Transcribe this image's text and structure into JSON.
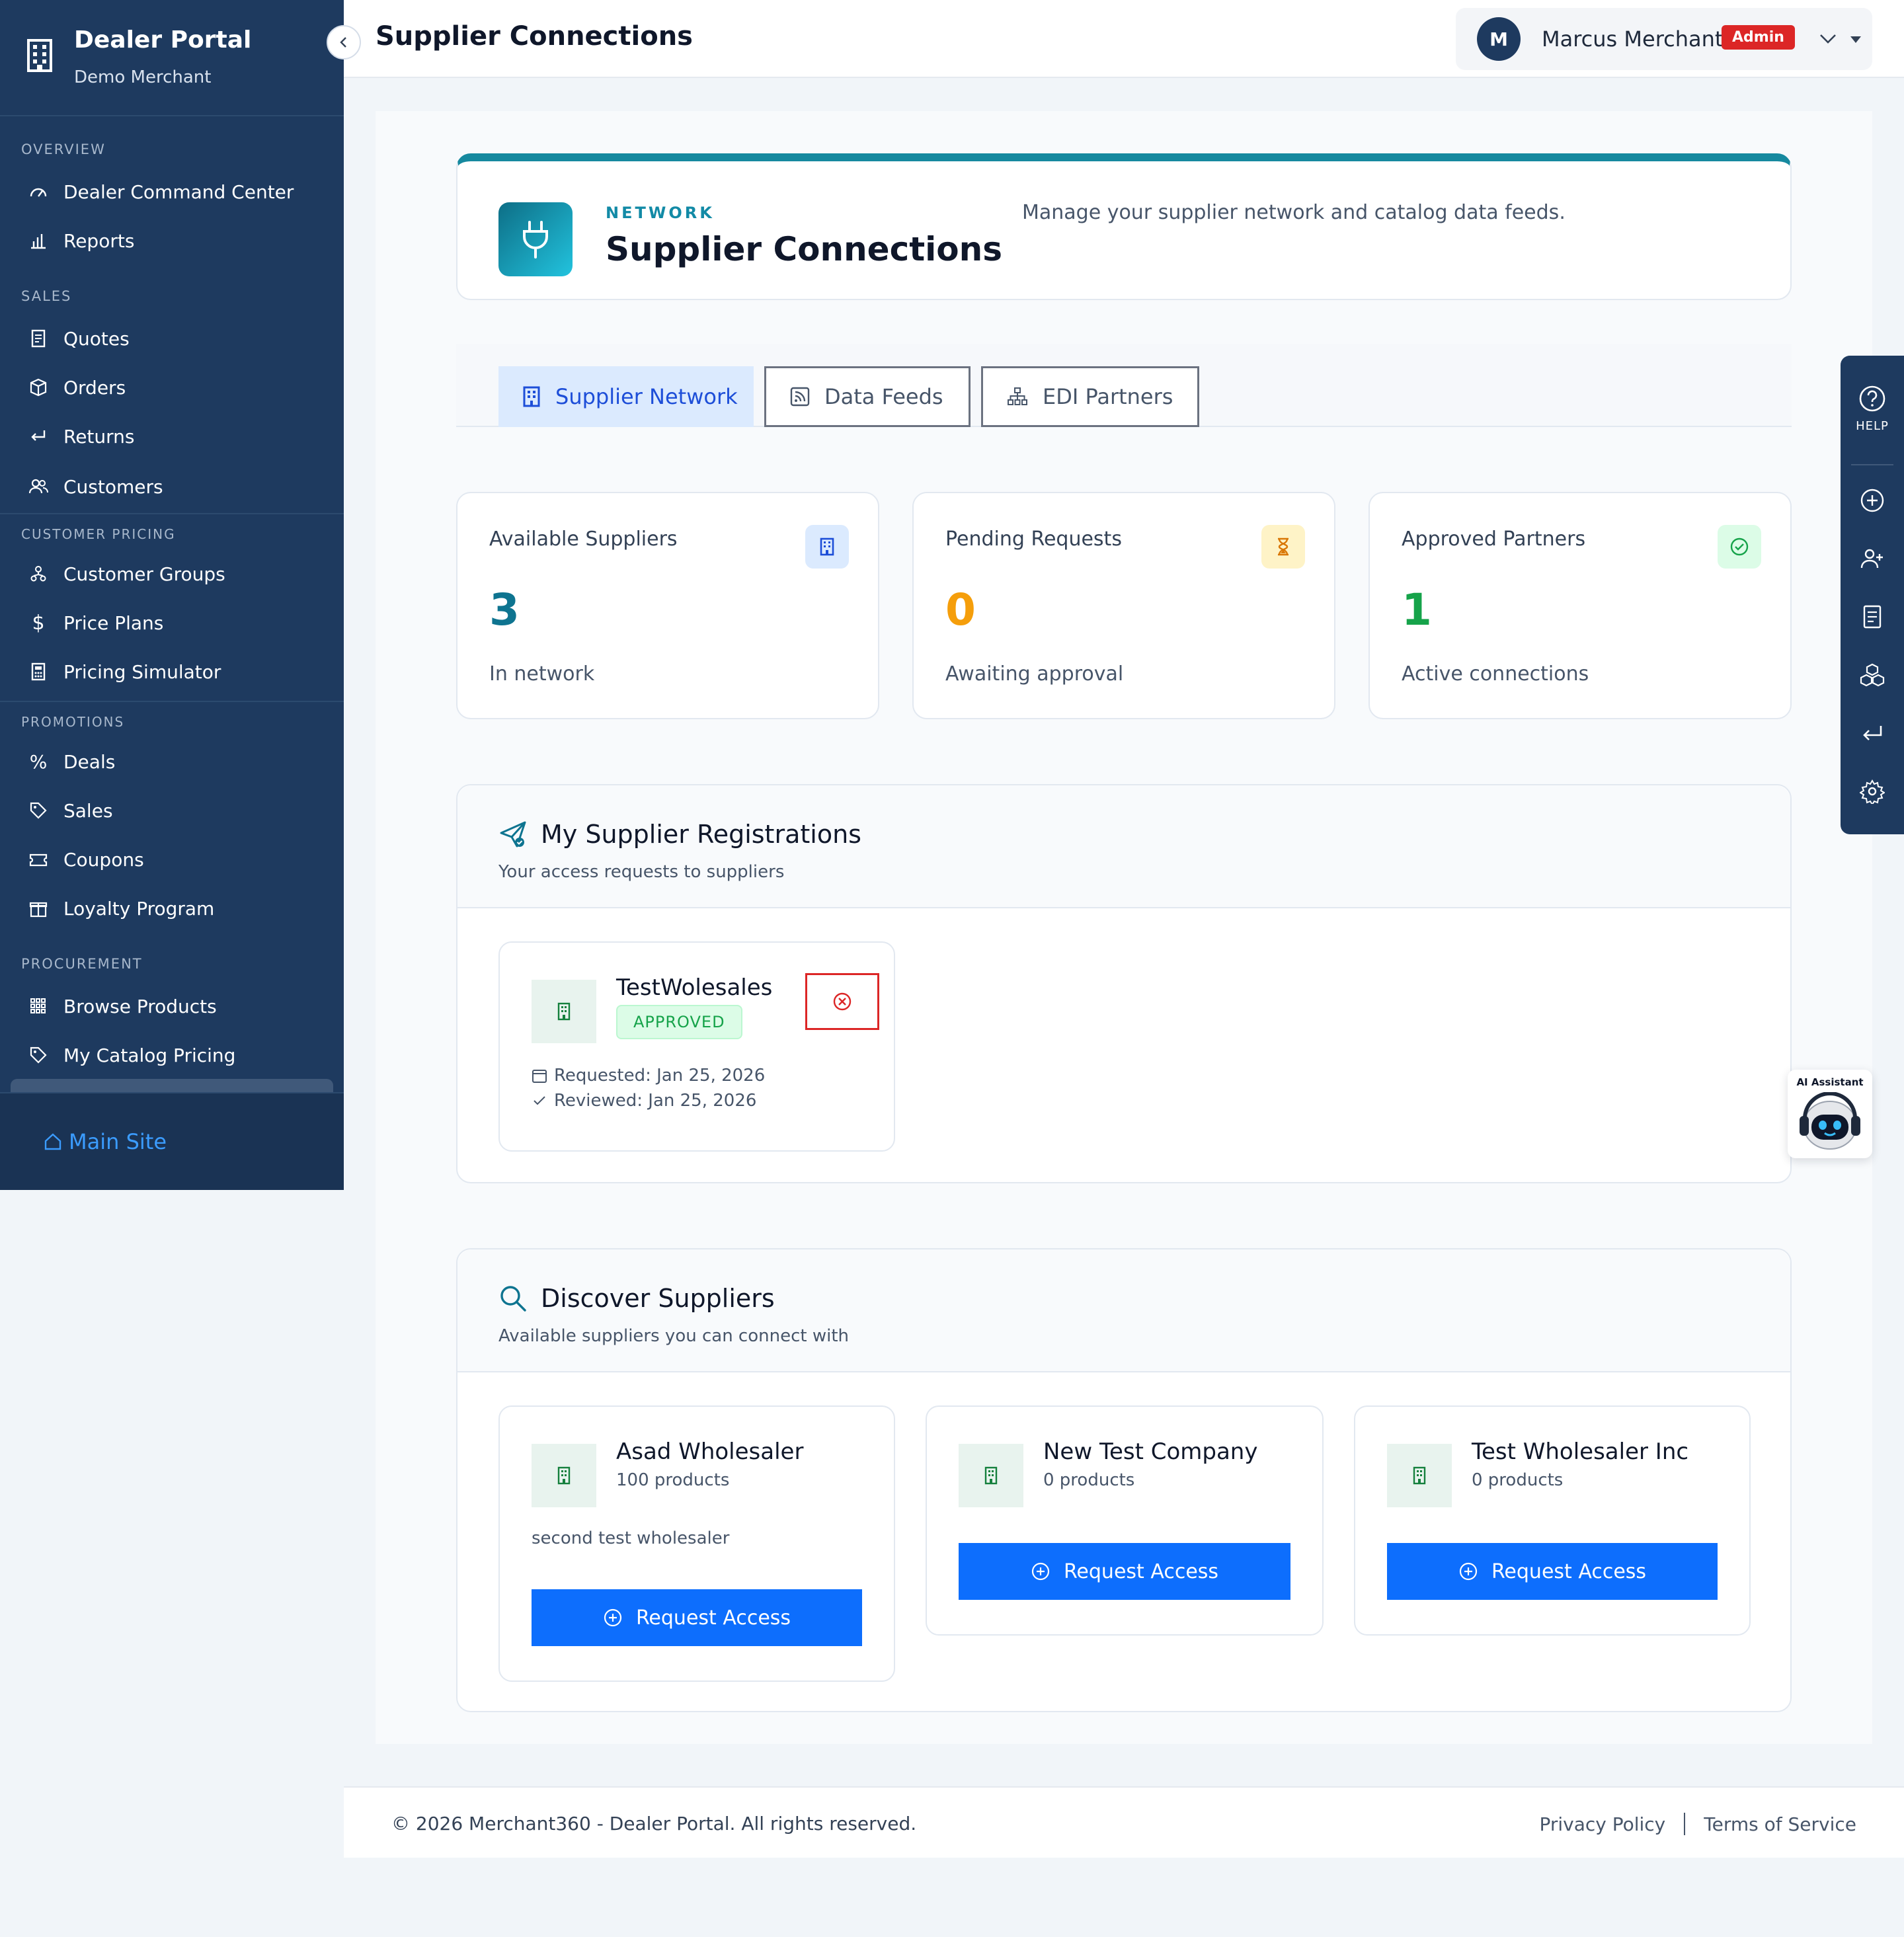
{
  "sidebar": {
    "brand_title": "Dealer Portal",
    "brand_subtitle": "Demo Merchant",
    "sections": {
      "overview": "OVERVIEW",
      "sales": "SALES",
      "customer_pricing": "CUSTOMER PRICING",
      "promotions": "PROMOTIONS",
      "procurement": "PROCUREMENT"
    },
    "items": {
      "dealer_command_center": "Dealer Command Center",
      "reports": "Reports",
      "quotes": "Quotes",
      "orders": "Orders",
      "returns": "Returns",
      "customers": "Customers",
      "customer_groups": "Customer Groups",
      "price_plans": "Price Plans",
      "pricing_simulator": "Pricing Simulator",
      "deals": "Deals",
      "sales": "Sales",
      "coupons": "Coupons",
      "loyalty_program": "Loyalty Program",
      "browse_products": "Browse Products",
      "my_catalog_pricing": "My Catalog Pricing"
    },
    "main_site": "Main Site"
  },
  "header": {
    "title": "Supplier Connections",
    "user_initial": "M",
    "user_name": "Marcus Merchant",
    "role_badge": "Admin"
  },
  "hero": {
    "kicker": "NETWORK",
    "title": "Supplier Connections",
    "description": "Manage your supplier network and catalog data feeds."
  },
  "tabs": [
    {
      "label": "Supplier Network",
      "active": true
    },
    {
      "label": "Data Feeds",
      "active": false
    },
    {
      "label": "EDI Partners",
      "active": false
    }
  ],
  "stats": [
    {
      "label": "Available Suppliers",
      "value": "3",
      "sub": "In network",
      "color": "#0e7490"
    },
    {
      "label": "Pending Requests",
      "value": "0",
      "sub": "Awaiting approval",
      "color": "#f59e0b"
    },
    {
      "label": "Approved Partners",
      "value": "1",
      "sub": "Active connections",
      "color": "#16a34a"
    }
  ],
  "registrations": {
    "title": "My Supplier Registrations",
    "subtitle": "Your access requests to suppliers",
    "items": [
      {
        "name": "TestWolesales",
        "status": "APPROVED",
        "requested": "Requested: Jan 25, 2026",
        "reviewed": "Reviewed: Jan 25, 2026"
      }
    ]
  },
  "discover": {
    "title": "Discover Suppliers",
    "subtitle": "Available suppliers you can connect with",
    "suppliers": [
      {
        "name": "Asad Wholesaler",
        "products": "100 products",
        "description": "second test wholesaler",
        "action": "Request Access"
      },
      {
        "name": "New Test Company",
        "products": "0 products",
        "description": "",
        "action": "Request Access"
      },
      {
        "name": "Test Wholesaler Inc",
        "products": "0 products",
        "description": "",
        "action": "Request Access"
      }
    ]
  },
  "footer": {
    "copyright": "© 2026 Merchant360 - Dealer Portal. All rights reserved.",
    "privacy": "Privacy Policy",
    "terms": "Terms of Service"
  },
  "help_rail": {
    "label": "HELP"
  },
  "ai_assistant": {
    "label": "AI Assistant"
  }
}
